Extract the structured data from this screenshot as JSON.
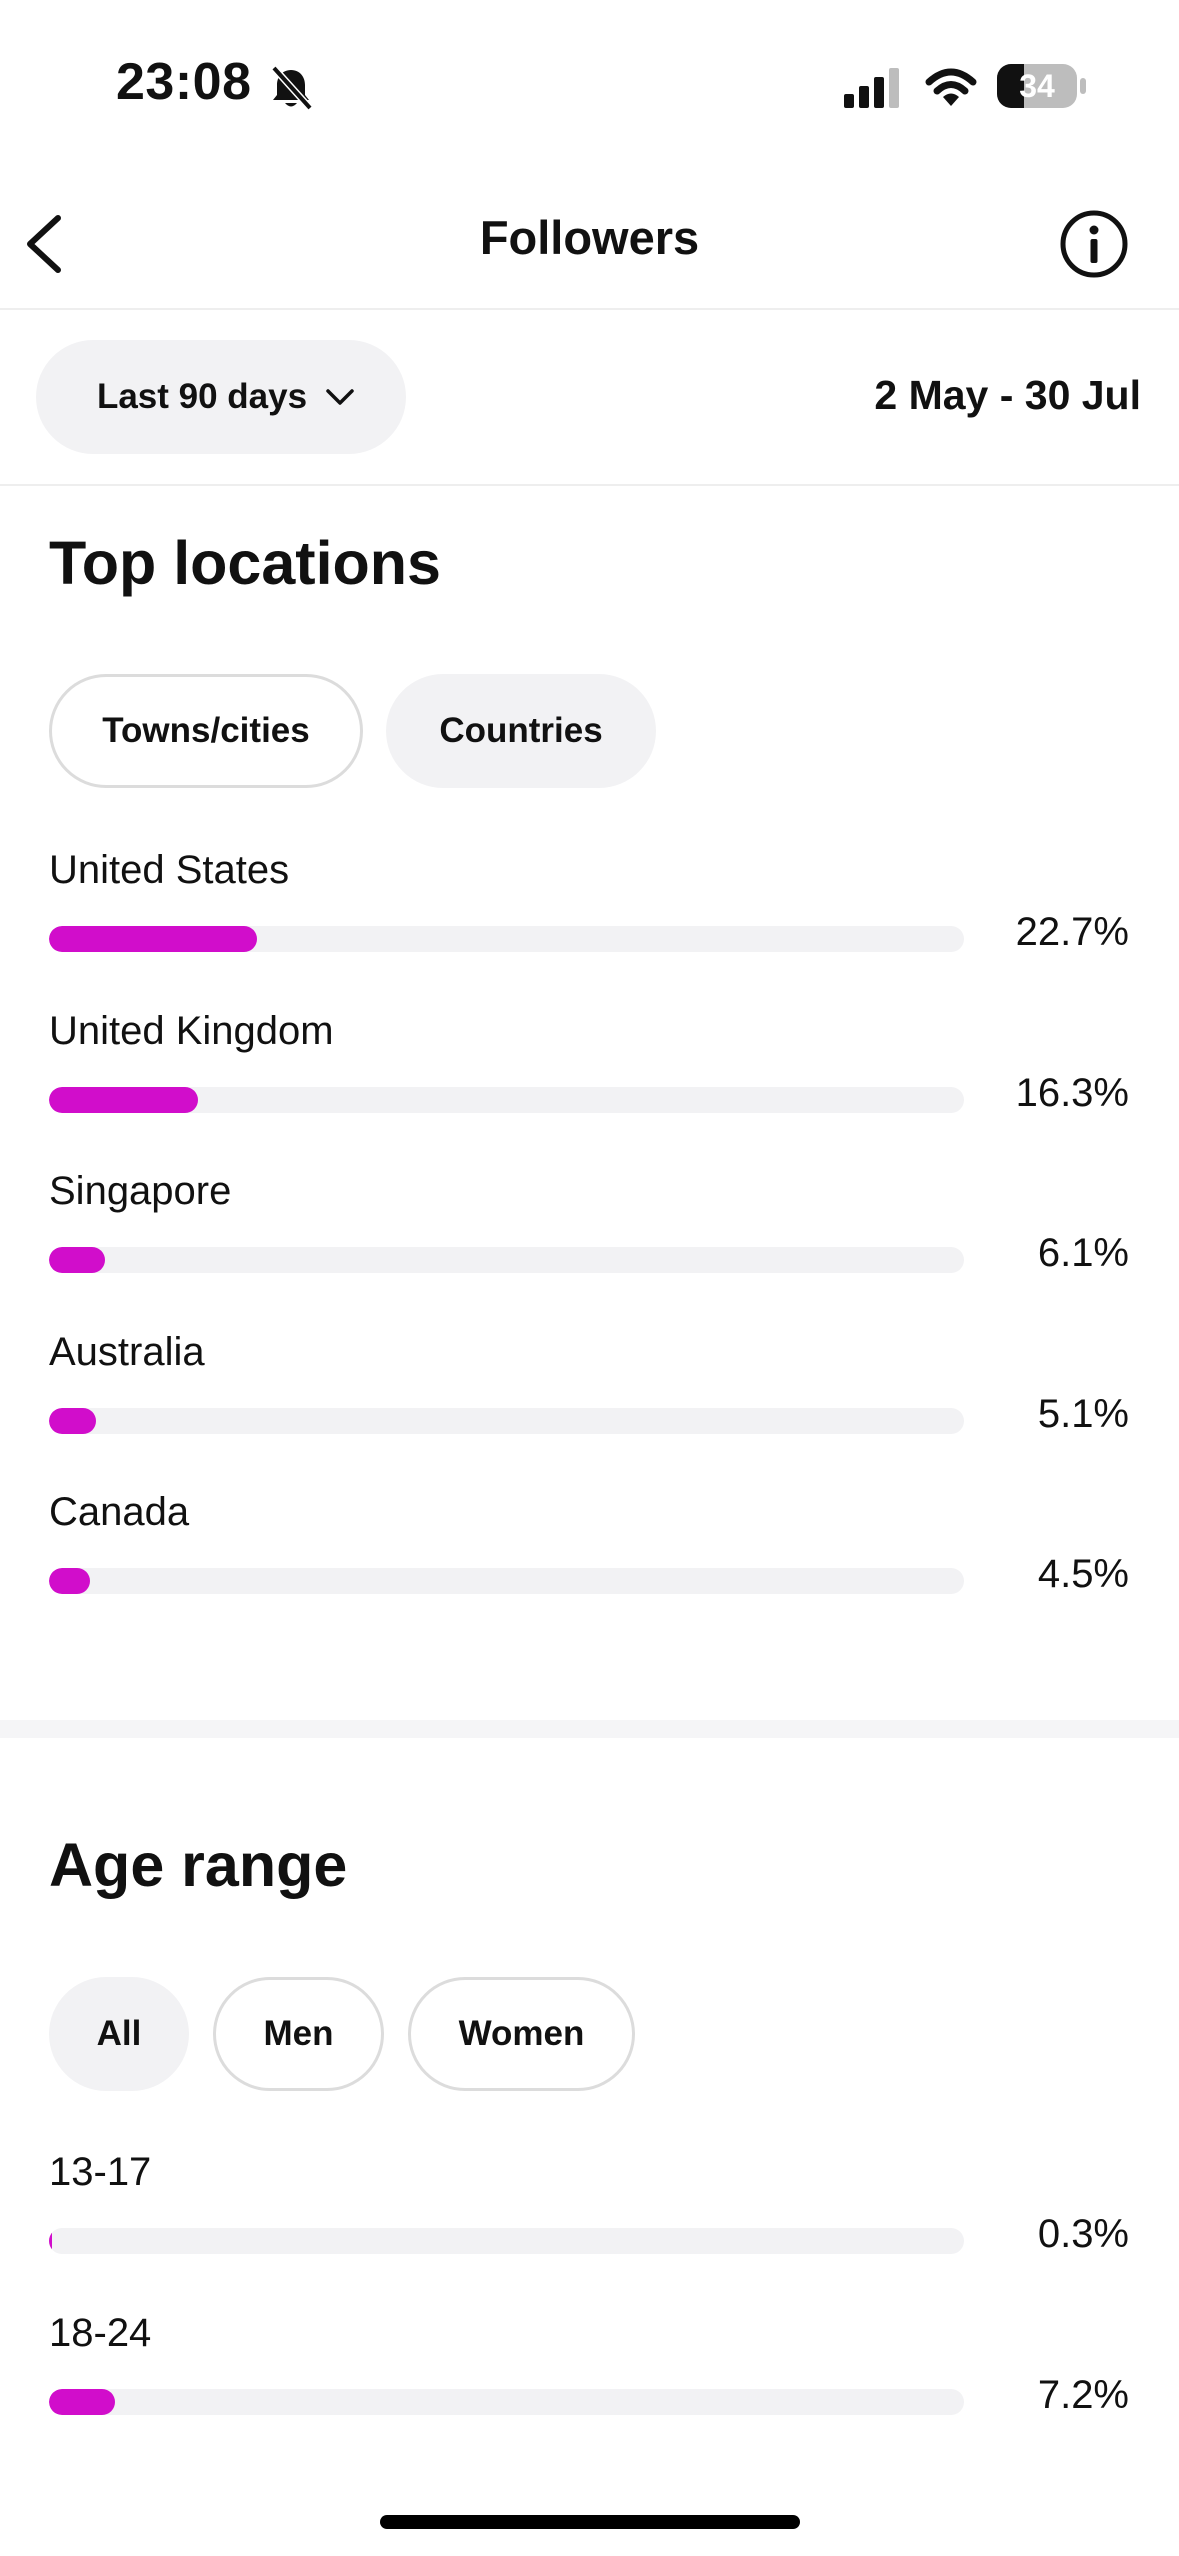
{
  "status_bar": {
    "time": "23:08",
    "battery": "34",
    "icons": [
      "bell-slash-icon",
      "cellular-signal-icon",
      "wifi-icon",
      "battery-icon"
    ]
  },
  "header": {
    "title": "Followers",
    "back_icon": "chevron-left-icon",
    "info_icon": "info-circle-icon"
  },
  "filter": {
    "range_label": "Last 90 days",
    "date_span": "2 May - 30 Jul"
  },
  "top_locations": {
    "title": "Top locations",
    "chips": [
      {
        "label": "Towns/cities",
        "selected": false
      },
      {
        "label": "Countries",
        "selected": true
      }
    ],
    "items": [
      {
        "label": "United States",
        "value": "22.7%",
        "fraction": 0.227
      },
      {
        "label": "United Kingdom",
        "value": "16.3%",
        "fraction": 0.163
      },
      {
        "label": "Singapore",
        "value": "6.1%",
        "fraction": 0.061
      },
      {
        "label": "Australia",
        "value": "5.1%",
        "fraction": 0.051
      },
      {
        "label": "Canada",
        "value": "4.5%",
        "fraction": 0.045
      }
    ]
  },
  "age_range": {
    "title": "Age range",
    "chips": [
      {
        "label": "All",
        "selected": true
      },
      {
        "label": "Men",
        "selected": false
      },
      {
        "label": "Women",
        "selected": false
      }
    ],
    "items": [
      {
        "label": "13-17",
        "value": "0.3%",
        "fraction": 0.003
      },
      {
        "label": "18-24",
        "value": "7.2%",
        "fraction": 0.072
      }
    ]
  },
  "colors": {
    "accent": "#d10dcb",
    "track": "#f2f2f4",
    "chip_fill": "#f2f2f4"
  }
}
